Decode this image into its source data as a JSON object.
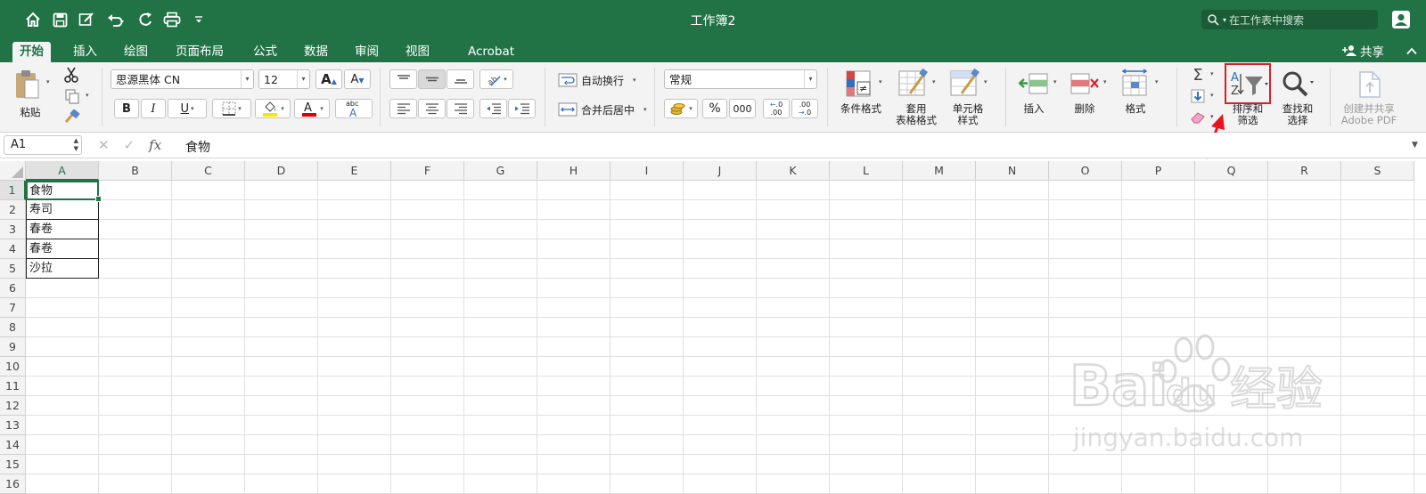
{
  "app": {
    "title": "工作簿2",
    "search_placeholder": "在工作表中搜索",
    "share_label": "共享",
    "accent_color": "#217346"
  },
  "tabs": [
    {
      "label": "开始",
      "active": true
    },
    {
      "label": "插入"
    },
    {
      "label": "绘图"
    },
    {
      "label": "页面布局"
    },
    {
      "label": "公式"
    },
    {
      "label": "数据"
    },
    {
      "label": "审阅"
    },
    {
      "label": "视图"
    },
    {
      "label": "Acrobat"
    }
  ],
  "ribbon": {
    "paste_label": "粘贴",
    "font_name": "思源黑体 CN",
    "font_size": "12",
    "bold": "B",
    "italic": "I",
    "underline": "U",
    "wrap_text_label": "自动换行",
    "merge_center_label": "合并后居中",
    "number_format": "常规",
    "percent": "%",
    "thousands": "000",
    "inc_decimal": ".00",
    "dec_decimal": ".0",
    "conditional_format_label": "条件格式",
    "format_table_label_1": "套用",
    "format_table_label_2": "表格格式",
    "cell_style_label_1": "单元格",
    "cell_style_label_2": "样式",
    "insert_label": "插入",
    "delete_label": "删除",
    "format_label": "格式",
    "sort_filter_label_1": "排序和",
    "sort_filter_label_2": "筛选",
    "find_select_label_1": "查找和",
    "find_select_label_2": "选择",
    "create_share_label_1": "创建并共享",
    "create_share_label_2": "Adobe PDF"
  },
  "formula_bar": {
    "name_box": "A1",
    "fx_label": "fx",
    "content": "食物"
  },
  "sheet": {
    "columns": [
      "A",
      "B",
      "C",
      "D",
      "E",
      "F",
      "G",
      "H",
      "I",
      "J",
      "K",
      "L",
      "M",
      "N",
      "O",
      "P",
      "Q",
      "R",
      "S"
    ],
    "rows": [
      "1",
      "2",
      "3",
      "4",
      "5",
      "6",
      "7",
      "8",
      "9",
      "10",
      "11",
      "12",
      "13",
      "14",
      "15",
      "16"
    ],
    "cells_A": [
      "食物",
      "寿司",
      "春卷",
      "春卷",
      "沙拉"
    ],
    "active_cell": "A1"
  },
  "watermark": {
    "brand": "Bai",
    "brand2": "du",
    "brand3": "经验",
    "url": "jingyan.baidu.com"
  }
}
